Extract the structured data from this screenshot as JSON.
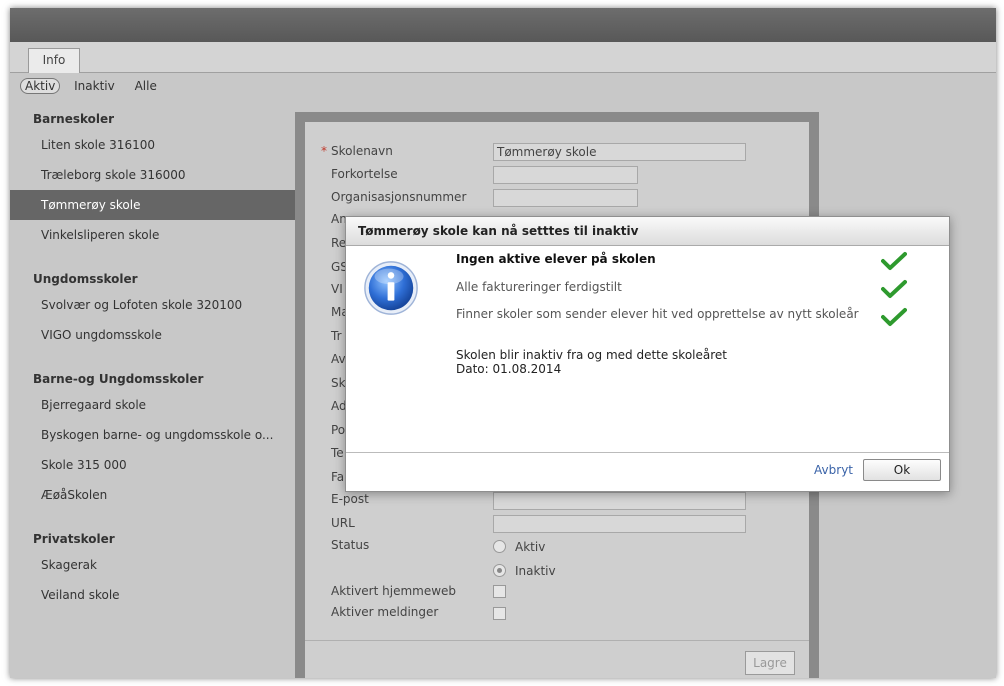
{
  "tabs": [
    {
      "label": "Info"
    }
  ],
  "filters": [
    {
      "label": "Aktiv",
      "active": true
    },
    {
      "label": "Inaktiv",
      "active": false
    },
    {
      "label": "Alle",
      "active": false
    }
  ],
  "sidebar": {
    "groups": [
      {
        "title": "Barneskoler",
        "items": [
          "Liten skole 316100",
          "Træleborg skole 316000",
          "Tømmerøy skole",
          "Vinkelsliperen skole"
        ]
      },
      {
        "title": "Ungdomsskoler",
        "items": [
          "Svolvær og Lofoten skole 320100",
          "VIGO ungdomsskole"
        ]
      },
      {
        "title": "Barne-og Ungdomsskoler",
        "items": [
          "Bjerregaard skole",
          "Byskogen barne- og ungdomsskole o...",
          "Skole 315 000",
          "ÆøåSkolen"
        ]
      },
      {
        "title": "Privatskoler",
        "items": [
          "Skagerak",
          "Veiland skole"
        ]
      }
    ],
    "selected": "Tømmerøy skole"
  },
  "form": {
    "required_marker": "*",
    "skolenavn_label": "Skolenavn",
    "skolenavn_value": "Tømmerøy skole",
    "forkortelse_label": "Forkortelse",
    "orgnr_label": "Organisasjonsnummer",
    "ansvar_label": "Ansvarsnummer",
    "partial_labels": [
      "Re",
      "GS",
      "VI",
      "Ma",
      "Tr",
      "Av",
      "Sk",
      "Ad",
      "Po",
      "Te",
      "Fa"
    ],
    "epost_label": "E-post",
    "url_label": "URL",
    "status_label": "Status",
    "status_options": [
      {
        "label": "Aktiv",
        "checked": false
      },
      {
        "label": "Inaktiv",
        "checked": true
      }
    ],
    "aktivert_hjemmeweb_label": "Aktivert hjemmeweb",
    "aktiver_meldinger_label": "Aktiver meldinger",
    "save_label": "Lagre"
  },
  "dialog": {
    "title": "Tømmerøy skole kan nå setttes til inaktiv",
    "icon": "info-icon",
    "checks": [
      {
        "text": "Ingen aktive elever på skolen",
        "bold": true,
        "icon": "checkmark-icon"
      },
      {
        "text": "Alle faktureringer ferdigstilt",
        "bold": false,
        "icon": "checkmark-icon"
      },
      {
        "text": "Finner skoler som sender elever hit ved opprettelse av nytt skoleår",
        "bold": false,
        "icon": "checkmark-icon"
      }
    ],
    "note_line1": "Skolen blir inaktiv fra og med dette skoleåret",
    "note_line2": "Dato: 01.08.2014",
    "cancel_label": "Avbryt",
    "ok_label": "Ok"
  },
  "colors": {
    "selected_bg": "#666666",
    "check_green": "#2e9a2e",
    "link": "#3a63a8",
    "required": "#c0392b"
  }
}
